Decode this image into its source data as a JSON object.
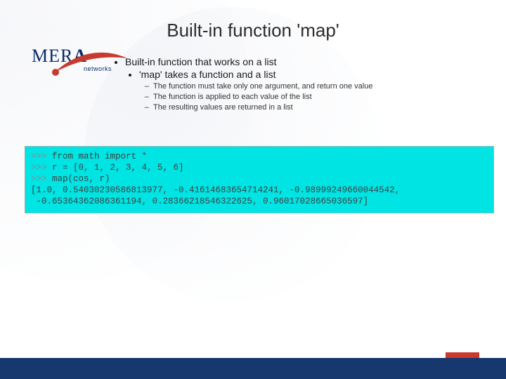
{
  "title": "Built-in function 'map'",
  "logo": {
    "brand_part1": "MER",
    "brand_part2": "A",
    "sub": "networks"
  },
  "bullets": {
    "l1": "Built-in function that works on a list",
    "l2": "'map' takes a function and a list",
    "l3a": "The function must take only one argument, and return one value",
    "l3b": "The function is applied to each value of the list",
    "l3c": "The resulting values are returned in a list"
  },
  "code": {
    "p": ">>> ",
    "line1": "from math import *",
    "line2": "r = [0, 1, 2, 3, 4, 5, 6]",
    "line3": "map(cos, r)",
    "out1": "[1.0, 0.54030230586813977, -0.41614683654714241, -0.98999249660044542,",
    "out2": " -0.65364362086361194, 0.28366218546322625, 0.96017028665036597]"
  }
}
